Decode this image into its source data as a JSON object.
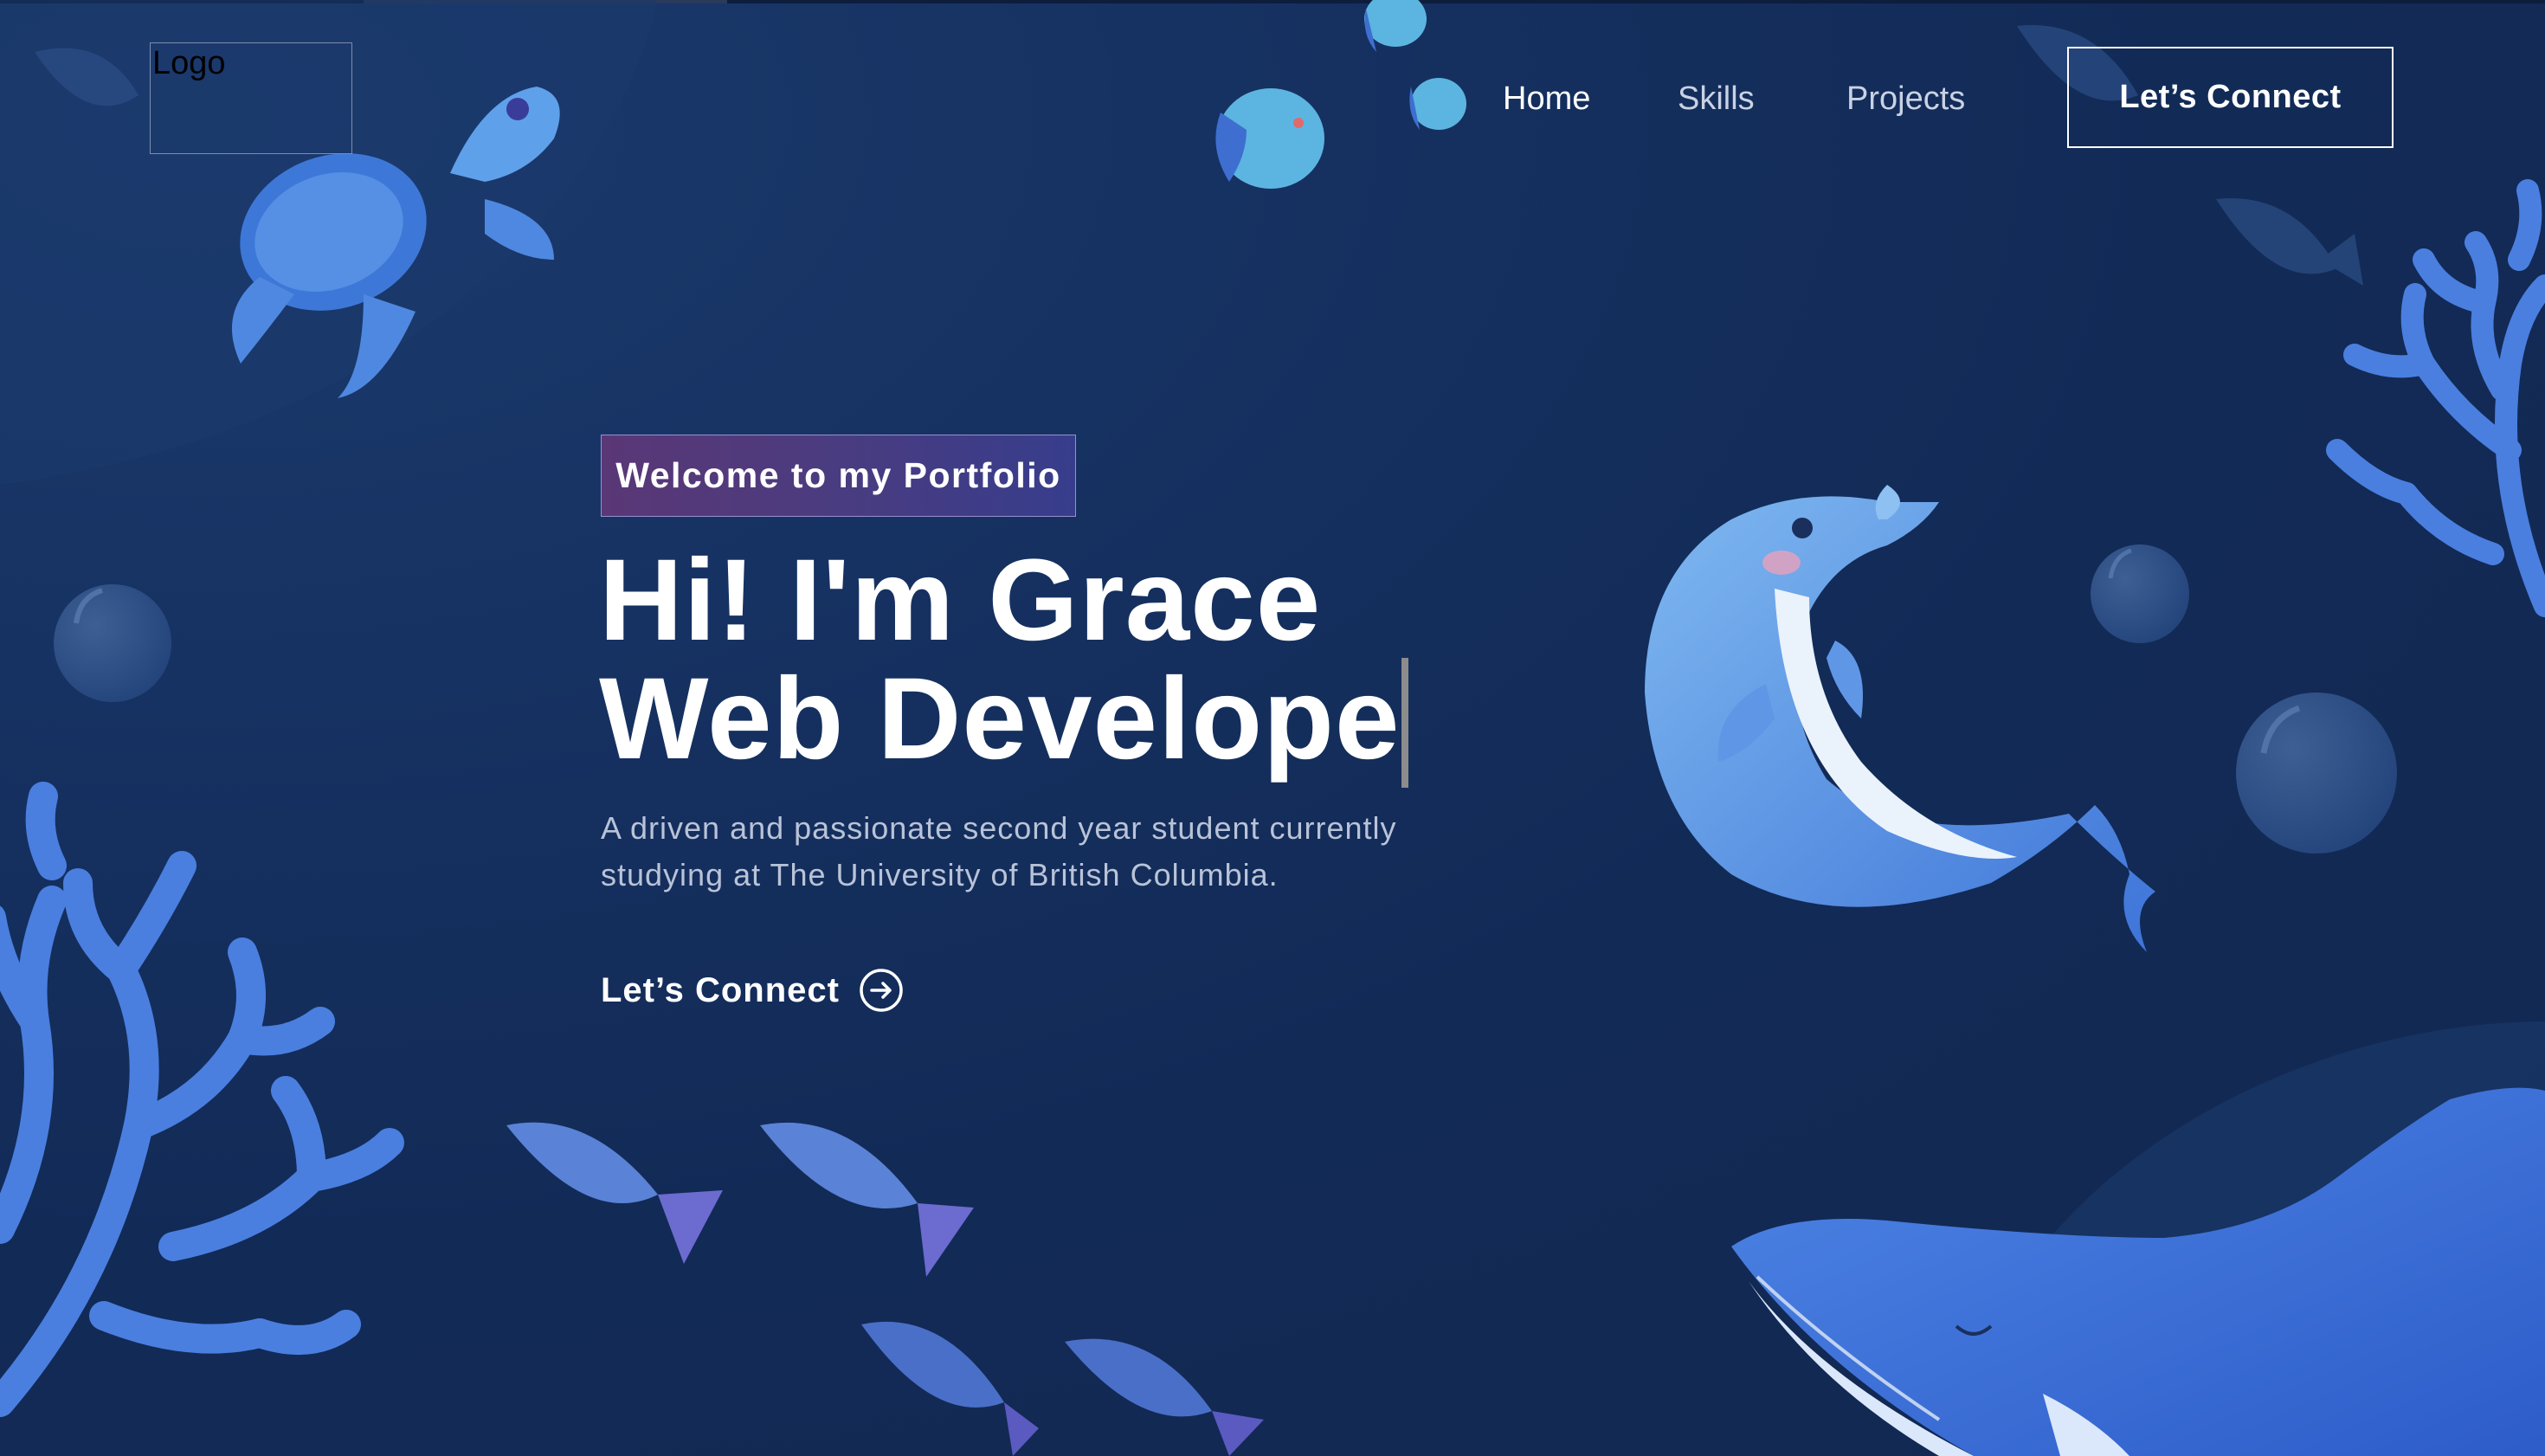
{
  "logo": {
    "text": "Logo"
  },
  "nav": {
    "items": [
      {
        "label": "Home"
      },
      {
        "label": "Skills"
      },
      {
        "label": "Projects"
      }
    ],
    "cta_label": "Let’s Connect"
  },
  "hero": {
    "tagline": "Welcome to my Portfolio",
    "title_line1": "Hi! I'm Grace",
    "title_line2": "Web Develope",
    "description": "A driven and passionate second year student currently studying at The University of British Columbia.",
    "cta_label": "Let’s Connect",
    "cta_icon": "arrow-right-circle-icon"
  },
  "colors": {
    "background": "#132b57",
    "tagline_gradient_start": "#5a3776",
    "tagline_gradient_end": "#373d8c",
    "text_primary": "#ffffff",
    "text_secondary": "#b9c3d8",
    "illustration_blue": "#4a7fe0"
  },
  "illustrations": [
    "sea-turtle-icon",
    "fish-icon",
    "dolphin-icon",
    "whale-icon",
    "coral-icon",
    "bubble-icon"
  ]
}
